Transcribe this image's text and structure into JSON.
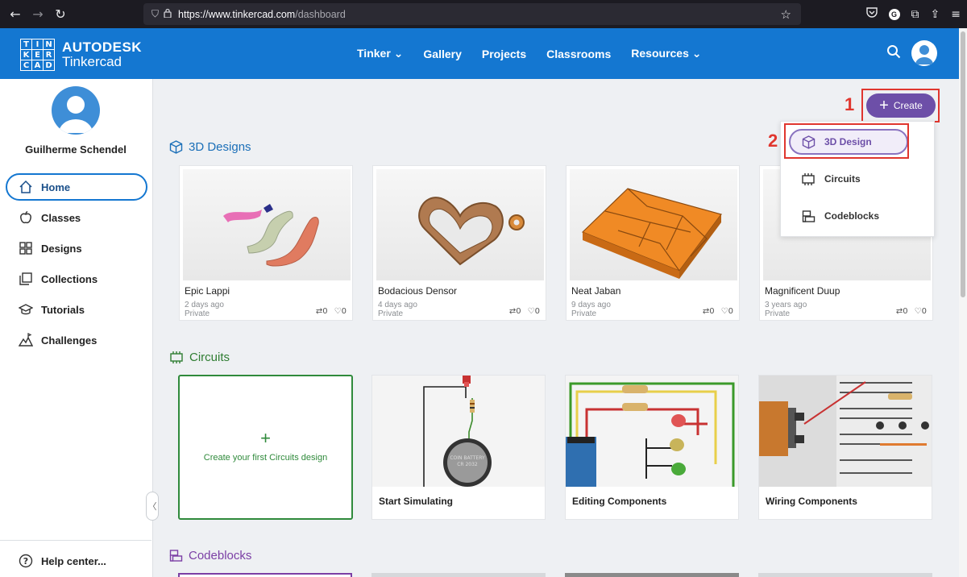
{
  "browser": {
    "url_host": "https://www.tinkercad.com",
    "url_path": "/dashboard",
    "back_icon": "back-arrow-icon",
    "forward_icon": "forward-arrow-icon",
    "reload_icon": "reload-icon",
    "profile_letter": "G"
  },
  "header": {
    "logo_letters": [
      "T",
      "I",
      "N",
      "K",
      "E",
      "R",
      "C",
      "A",
      "D"
    ],
    "brand_line1": "AUTODESK",
    "brand_line2": "Tinkercad",
    "nav": [
      {
        "label": "Tinker ⌄"
      },
      {
        "label": "Gallery"
      },
      {
        "label": "Projects"
      },
      {
        "label": "Classrooms"
      },
      {
        "label": "Resources ⌄"
      }
    ]
  },
  "sidebar": {
    "user_name": "Guilherme Schendel",
    "items": [
      {
        "label": "Home",
        "icon": "home-icon"
      },
      {
        "label": "Classes",
        "icon": "apple-icon"
      },
      {
        "label": "Designs",
        "icon": "grid-icon"
      },
      {
        "label": "Collections",
        "icon": "collections-icon"
      },
      {
        "label": "Tutorials",
        "icon": "graduation-cap-icon"
      },
      {
        "label": "Challenges",
        "icon": "challenges-icon"
      }
    ],
    "help_label": "Help center...",
    "collapse_glyph": "〈"
  },
  "sections": {
    "designs_title": "3D Designs",
    "circuits_title": "Circuits",
    "codeblocks_title": "Codeblocks"
  },
  "designs": [
    {
      "name": "Epic Lappi",
      "date": "2 days ago",
      "privacy": "Private",
      "remixes": "0",
      "likes": "0"
    },
    {
      "name": "Bodacious Densor",
      "date": "4 days ago",
      "privacy": "Private",
      "remixes": "0",
      "likes": "0"
    },
    {
      "name": "Neat Jaban",
      "date": "9 days ago",
      "privacy": "Private",
      "remixes": "0",
      "likes": "0"
    },
    {
      "name": "Magnificent Duup",
      "date": "3 years ago",
      "privacy": "Private",
      "remixes": "0",
      "likes": "0"
    }
  ],
  "circuits": {
    "create_plus": "+",
    "create_label": "Create your first Circuits design",
    "cards": [
      {
        "label": "Start Simulating"
      },
      {
        "label": "Editing Components"
      },
      {
        "label": "Wiring Components"
      }
    ],
    "battery_label": "COIN BATTERY CR 2032 3.0V"
  },
  "create_menu": {
    "button_label": "Create",
    "items": [
      {
        "label": "3D Design",
        "icon": "cube-icon"
      },
      {
        "label": "Circuits",
        "icon": "chip-icon"
      },
      {
        "label": "Codeblocks",
        "icon": "codeblocks-icon"
      }
    ],
    "annotation_1": "1",
    "annotation_2": "2"
  },
  "colors": {
    "header_blue": "#1477d1",
    "create_purple": "#6d4fa8",
    "highlight_red": "#e0362e",
    "circuits_green": "#2f8a3b"
  }
}
